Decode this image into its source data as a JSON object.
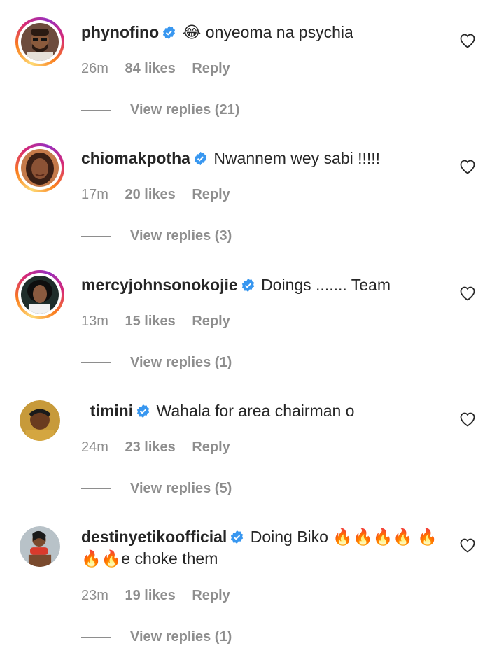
{
  "comments": [
    {
      "username": "phynofino",
      "text": "😂 onyeoma na psychia",
      "time": "26m",
      "likes": "84 likes",
      "reply": "Reply",
      "view_replies": "View replies (21)",
      "story_ring": true
    },
    {
      "username": "chiomakpotha",
      "text": "Nwannem wey sabi !!!!!",
      "time": "17m",
      "likes": "20 likes",
      "reply": "Reply",
      "view_replies": "View replies (3)",
      "story_ring": true
    },
    {
      "username": "mercyjohnsonokojie",
      "text": "Doings ....... Team",
      "time": "13m",
      "likes": "15 likes",
      "reply": "Reply",
      "view_replies": "View replies (1)",
      "story_ring": true
    },
    {
      "username": "_timini",
      "text": "Wahala for area chairman o",
      "time": "24m",
      "likes": "23 likes",
      "reply": "Reply",
      "view_replies": "View replies (5)",
      "story_ring": false
    },
    {
      "username": "destinyetikoofficial",
      "text": "Doing Biko 🔥🔥🔥🔥 🔥🔥🔥e choke them",
      "time": "23m",
      "likes": "19 likes",
      "reply": "Reply",
      "view_replies": "View replies (1)",
      "story_ring": false
    }
  ],
  "icons": {
    "verified": "verified-badge-icon",
    "like": "heart-outline-icon"
  },
  "colors": {
    "verified_blue": "#3897f0",
    "meta_gray": "#8e8e8e",
    "text": "#262626"
  }
}
